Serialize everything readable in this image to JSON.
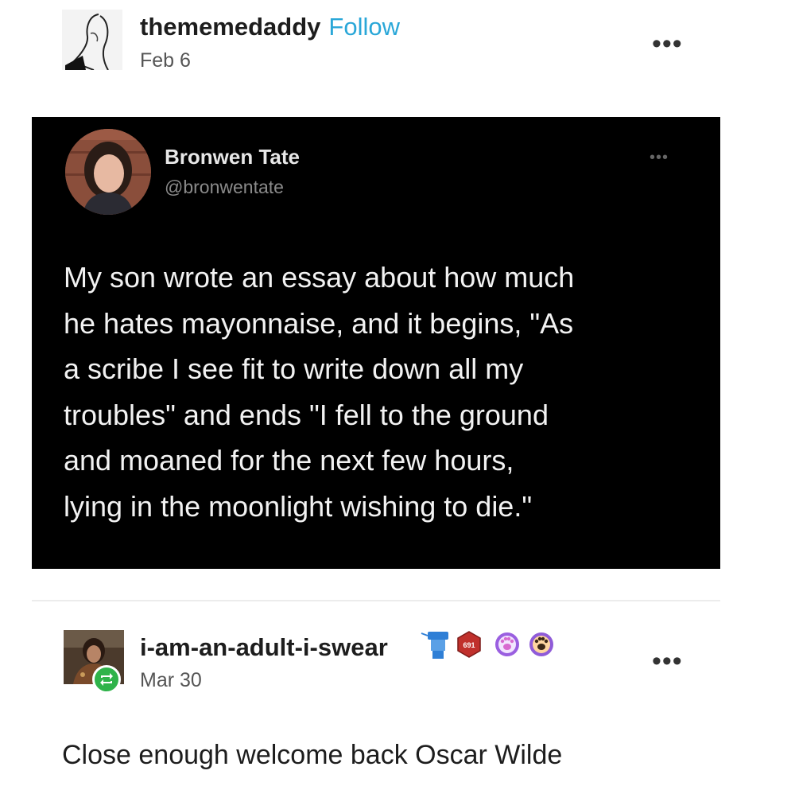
{
  "post": {
    "author": "thememedaddy",
    "follow_label": "Follow",
    "date": "Feb 6",
    "more_label": "•••"
  },
  "tweet": {
    "name": "Bronwen Tate",
    "handle": "@bronwentate",
    "more_label": "•••",
    "lines": [
      "My son wrote an essay about how much",
      "he hates mayonnaise, and it begins, \"As",
      "a scribe I see fit to write down all my",
      "troubles\" and ends \"I fell to the ground",
      "and moaned for the next few hours,",
      "lying in the moonlight wishing to die.\""
    ]
  },
  "reblog": {
    "author": "i-am-an-adult-i-swear",
    "badge_number": "691",
    "date": "Mar 30",
    "more_label": "•••",
    "comment": "Close enough welcome back Oscar Wilde"
  },
  "colors": {
    "follow": "#2aa7d8",
    "tweet_bg": "#000000",
    "reblog_green": "#2fb34a",
    "badge_red": "#c0302c",
    "badge_purple": "#8f5bd8"
  }
}
